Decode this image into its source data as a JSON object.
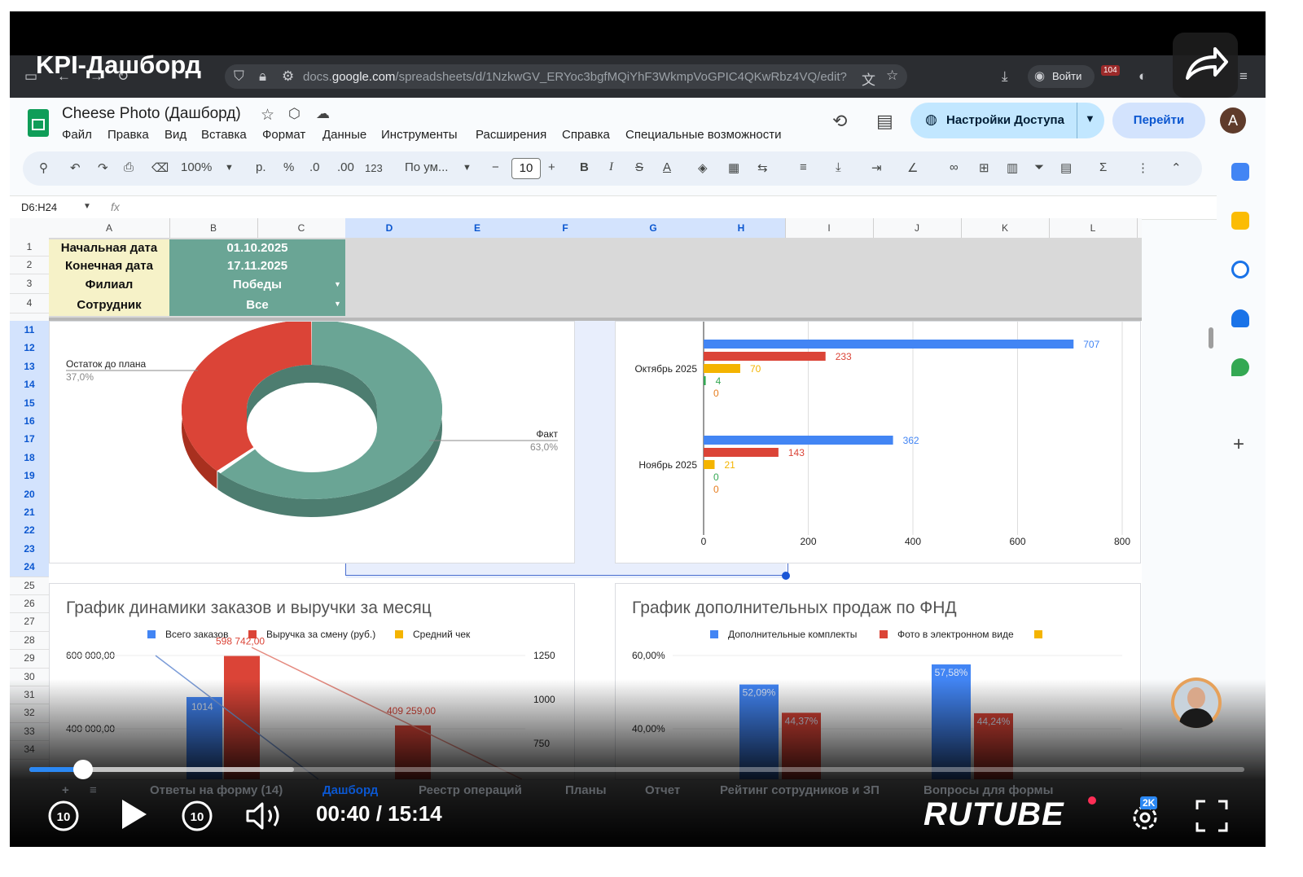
{
  "video": {
    "title": "KPI-Дашборд",
    "time": "00:40 / 15:14",
    "progress_fraction": 0.044,
    "buffered_fraction": 0.218,
    "brand": "RUTUBE",
    "quality_badge": "2K"
  },
  "browser": {
    "url_prefix": "docs.",
    "url_domain": "google.com",
    "url_path": "/spreadsheets/d/1NzkwGV_ERYoc3bgfMQiYhF3WkmpVoGPIC4QKwRbz4VQ/edit?",
    "signin": "Войти",
    "badge_count": "104"
  },
  "sheets": {
    "doc_title": "Cheese Photo (Дашборд)",
    "menu": [
      "Файл",
      "Правка",
      "Вид",
      "Вставка",
      "Формат",
      "Данные",
      "Инструменты",
      "Расширения",
      "Справка",
      "Специальные возможности"
    ],
    "share_label": "Настройки Доступа",
    "goto_label": "Перейти",
    "avatar_letter": "A",
    "toolbar": {
      "zoom": "100%",
      "currency": "р.",
      "percent": "%",
      "dec_less": ".0",
      "dec_more": ".00",
      "format_123": "123",
      "font": "По ум...",
      "font_size": "10",
      "bold": "B",
      "italic": "I",
      "strike": "S",
      "text_color": "A"
    },
    "name_box": "D6:H24",
    "fx": "fx"
  },
  "grid": {
    "columns": [
      "A",
      "B",
      "C",
      "D",
      "E",
      "F",
      "G",
      "H",
      "I",
      "J",
      "K",
      "L"
    ],
    "selected_columns": [
      "D",
      "E",
      "F",
      "G",
      "H"
    ],
    "rows": [
      "1",
      "2",
      "3",
      "4",
      "11",
      "12",
      "13",
      "14",
      "15",
      "16",
      "17",
      "18",
      "19",
      "20",
      "21",
      "22",
      "23",
      "24",
      "25",
      "26",
      "27",
      "28",
      "29",
      "30",
      "31",
      "32",
      "33",
      "34"
    ],
    "selected_rows": [
      "11",
      "12",
      "13",
      "14",
      "15",
      "16",
      "17",
      "18",
      "19",
      "20",
      "21",
      "22",
      "23",
      "24"
    ],
    "filters": [
      {
        "label": "Начальная дата",
        "value": "01.10.2025"
      },
      {
        "label": "Конечная дата",
        "value": "17.11.2025"
      },
      {
        "label": "Филиал",
        "value": "Победы"
      },
      {
        "label": "Сотрудник",
        "value": "Все"
      }
    ]
  },
  "sheet_tabs": [
    "Ответы на форму (14)",
    "Дашборд",
    "Реестр операций",
    "Планы",
    "Отчет",
    "Рейтинг сотрудников и ЗП",
    "Вопросы для формы"
  ],
  "colors": {
    "green": "#6aa595",
    "red": "#db4437",
    "blue": "#4285f4",
    "yellow": "#f4b400",
    "dark_green": "#34a853",
    "orange": "#e67c1d"
  },
  "chart_data": [
    {
      "type": "pie",
      "variant": "donut-3d",
      "slices": [
        {
          "label": "Факт",
          "value": 63.0,
          "display": "63,0%",
          "color": "#6aa595"
        },
        {
          "label": "Остаток до плана",
          "value": 37.0,
          "display": "37,0%",
          "color": "#db4437"
        }
      ]
    },
    {
      "type": "bar",
      "orientation": "horizontal",
      "categories": [
        "Октябрь 2025",
        "Ноябрь 2025"
      ],
      "series": [
        {
          "values": [
            707,
            362
          ],
          "color": "#4285f4"
        },
        {
          "values": [
            233,
            143
          ],
          "color": "#db4437"
        },
        {
          "values": [
            70,
            21
          ],
          "color": "#f4b400"
        },
        {
          "values": [
            4,
            0
          ],
          "color": "#34a853"
        },
        {
          "values": [
            0,
            0
          ],
          "color": "#e67c1d"
        }
      ],
      "xlim": [
        0,
        800
      ],
      "xticks": [
        "0",
        "200",
        "400",
        "600",
        "800"
      ]
    },
    {
      "type": "bar",
      "title": "График динамики заказов и выручки за месяц",
      "legend": [
        "Всего заказов",
        "Выручка за смену (руб.)",
        "Средний чек"
      ],
      "left_ticks": [
        "600 000,00",
        "400 000,00"
      ],
      "right_ticks": [
        "1250",
        "1000",
        "750"
      ],
      "bars": [
        {
          "series": "Всего заказов",
          "value": 1014,
          "label": "1014",
          "color": "#4285f4"
        },
        {
          "series": "Выручка за смену (руб.)",
          "value": 598742,
          "label": "598 742,00",
          "color": "#db4437"
        },
        {
          "series": "Выручка за смену (руб.)",
          "value": 409259,
          "label": "409 259,00",
          "color": "#db4437"
        }
      ]
    },
    {
      "type": "bar",
      "title": "График дополнительных продаж по ФНД",
      "legend": [
        "Дополнительные комплекты",
        "Фото в электронном виде",
        ""
      ],
      "yticks": [
        "60,00%",
        "40,00%"
      ],
      "ylim": [
        0,
        60
      ],
      "bars": [
        {
          "series": "Дополнительные комплекты",
          "value": 52.09,
          "label": "52,09%",
          "color": "#4285f4"
        },
        {
          "series": "Фото в электронном виде",
          "value": 44.37,
          "label": "44,37%",
          "color": "#db4437"
        },
        {
          "series": "Дополнительные комплекты",
          "value": 57.58,
          "label": "57,58%",
          "color": "#4285f4"
        },
        {
          "series": "Фото в электронном виде",
          "value": 44.24,
          "label": "44,24%",
          "color": "#db4437"
        }
      ]
    }
  ]
}
